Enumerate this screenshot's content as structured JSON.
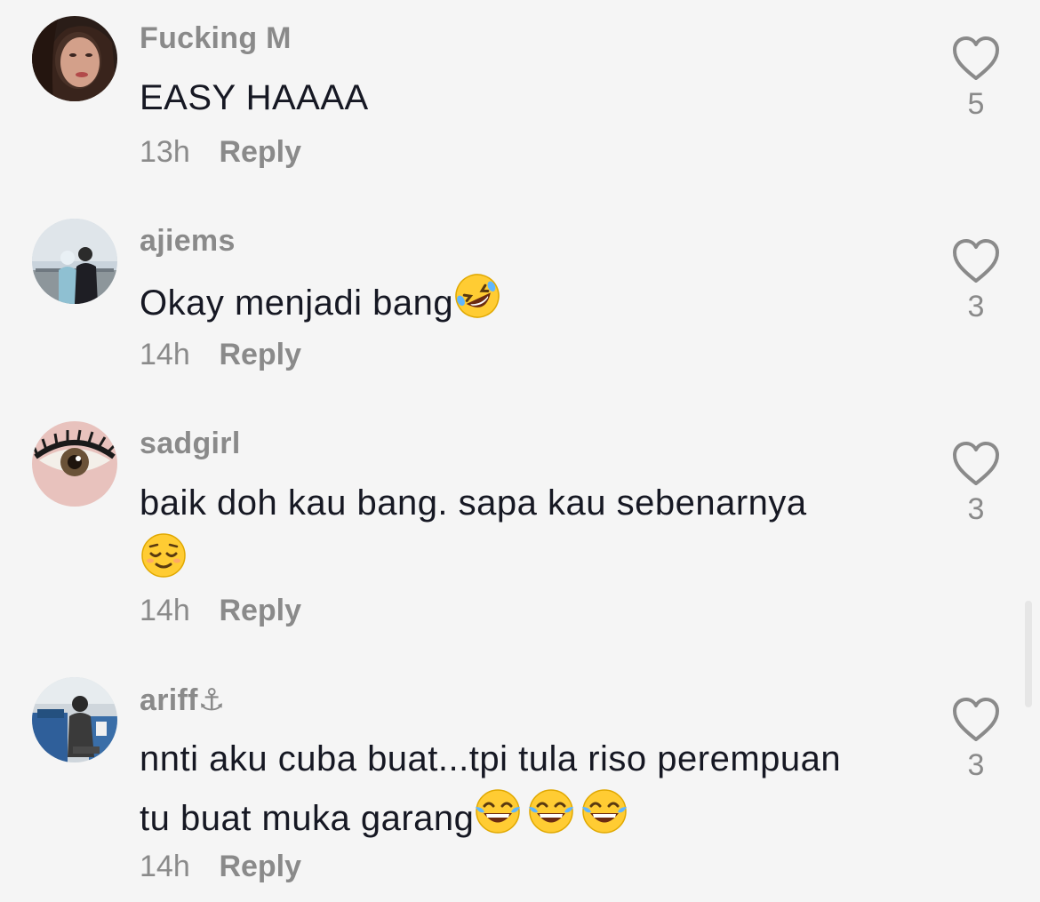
{
  "comments": [
    {
      "username": "Fucking M",
      "text": "EASY HAAAA",
      "time": "13h",
      "reply_label": "Reply",
      "likes": "5",
      "avatar": "avatar-woman-dark-hair"
    },
    {
      "username": "ajiems",
      "text": "Okay menjadi bang",
      "time": "14h",
      "reply_label": "Reply",
      "likes": "3",
      "emoji": "rolling-on-floor-laughing-emoji",
      "avatar": "avatar-couple-outdoor"
    },
    {
      "username": "sadgirl",
      "text": "baik doh kau bang. sapa kau sebenarnya",
      "time": "14h",
      "reply_label": "Reply",
      "likes": "3",
      "emoji": "relieved-face-emoji",
      "avatar": "avatar-eye-closeup"
    },
    {
      "username": "ariff",
      "username_suffix": "⚓",
      "text_line1": "nnti aku cuba buat...tpi tula riso perempuan",
      "text_line2": "tu buat muka garang",
      "time": "14h",
      "reply_label": "Reply",
      "likes": "3",
      "emoji": "face-with-tears-of-joy-emoji x3",
      "avatar": "avatar-person-sitting-blue-seats"
    }
  ],
  "colors": {
    "background": "#f5f5f5",
    "username": "#8a8a8a",
    "text": "#161823",
    "meta": "#8a8a8a"
  }
}
